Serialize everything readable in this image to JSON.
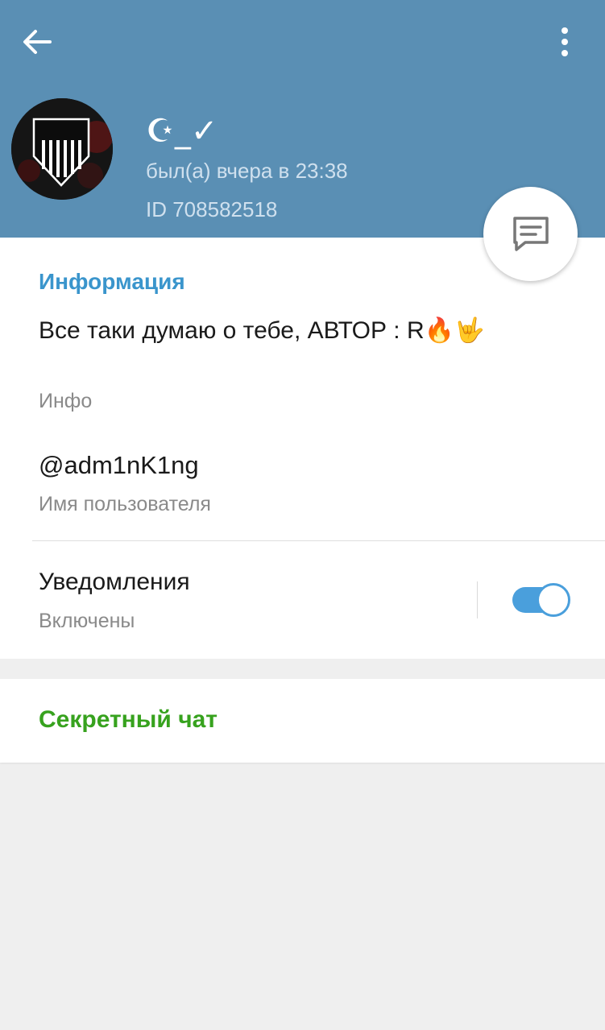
{
  "colors": {
    "header": "#5a8fb4",
    "accent": "#3a95cc",
    "toggle": "#4a9fdc",
    "secret_chat": "#37a21e"
  },
  "header": {
    "back_icon": "arrow-left-icon",
    "menu_icon": "more-vertical-icon",
    "name": "☪_✓",
    "status": "был(а) вчера в 23:38",
    "id": "ID 708582518"
  },
  "fab": {
    "icon": "message-icon"
  },
  "info": {
    "section_title": "Информация",
    "bio": "Все таки думаю о тебе, АВТОР : R🔥🤟",
    "bio_label": "Инфо",
    "username": "@adm1nK1ng",
    "username_label": "Имя пользователя",
    "notifications": "Уведомления",
    "notifications_status": "Включены",
    "notifications_enabled": true
  },
  "secret_chat": "Секретный чат"
}
